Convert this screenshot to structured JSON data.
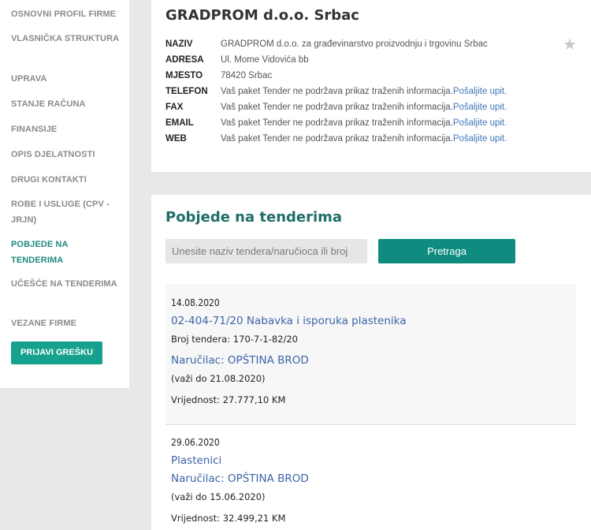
{
  "sidebar": {
    "items": [
      {
        "label": "OSNOVNI PROFIL FIRME"
      },
      {
        "label": "VLASNIČKA STRUKTURA"
      },
      {
        "label": "UPRAVA"
      },
      {
        "label": "STANJE RAČUNA"
      },
      {
        "label": "FINANSIJE"
      },
      {
        "label": "OPIS DJELATNOSTI"
      },
      {
        "label": "DRUGI KONTAKTI"
      },
      {
        "label": "ROBE I USLUGE (CPV - JRJN)"
      },
      {
        "label": "POBJEDE NA TENDERIMA"
      },
      {
        "label": "UČEŠĆE NA TENDERIMA"
      },
      {
        "label": "VEZANE FIRME"
      }
    ],
    "report_button": "PRIJAVI GREŠKU"
  },
  "company": {
    "title": "GRADPROM d.o.o. Srbac",
    "star_icon": "★",
    "rows": [
      {
        "label": "NAZIV",
        "value": "GRADPROM d.o.o. za građevinarstvo proizvodnju i trgovinu Srbac",
        "link": ""
      },
      {
        "label": "ADRESA",
        "value": "Ul. Mome Vidovića bb",
        "link": ""
      },
      {
        "label": "MJESTO",
        "value": "78420 Srbac",
        "link": ""
      },
      {
        "label": "TELEFON",
        "value": "Vaš paket Tender ne podržava prikaz traženih informacija.",
        "link": "Pošaljite upit."
      },
      {
        "label": "FAX",
        "value": "Vaš paket Tender ne podržava prikaz traženih informacija.",
        "link": "Pošaljite upit."
      },
      {
        "label": "EMAIL",
        "value": "Vaš paket Tender ne podržava prikaz traženih informacija.",
        "link": "Pošaljite upit."
      },
      {
        "label": "WEB",
        "value": "Vaš paket Tender ne podržava prikaz traženih informacija.",
        "link": "Pošaljite upit."
      }
    ]
  },
  "tenders_section": {
    "title": "Pobjede na tenderima",
    "search_placeholder": "Unesite naziv tendera/naručioca ili broj",
    "search_button": "Pretraga",
    "items": [
      {
        "date": "14.08.2020",
        "title": "02-404-71/20 Nabavka i isporuka plastenika",
        "number": "Broj tendera: 170-7-1-82/20",
        "buyer": "Naručilac: OPŠTINA BROD",
        "valid": "(važi do 21.08.2020)",
        "value": "Vrijednost: 27.777,10 KM"
      },
      {
        "date": "29.06.2020",
        "title": "Plastenici",
        "buyer": "Naručilac: OPŠTINA BROD",
        "valid": "(važi do 15.06.2020)",
        "value": "Vrijednost: 32.499,21 KM"
      }
    ]
  }
}
